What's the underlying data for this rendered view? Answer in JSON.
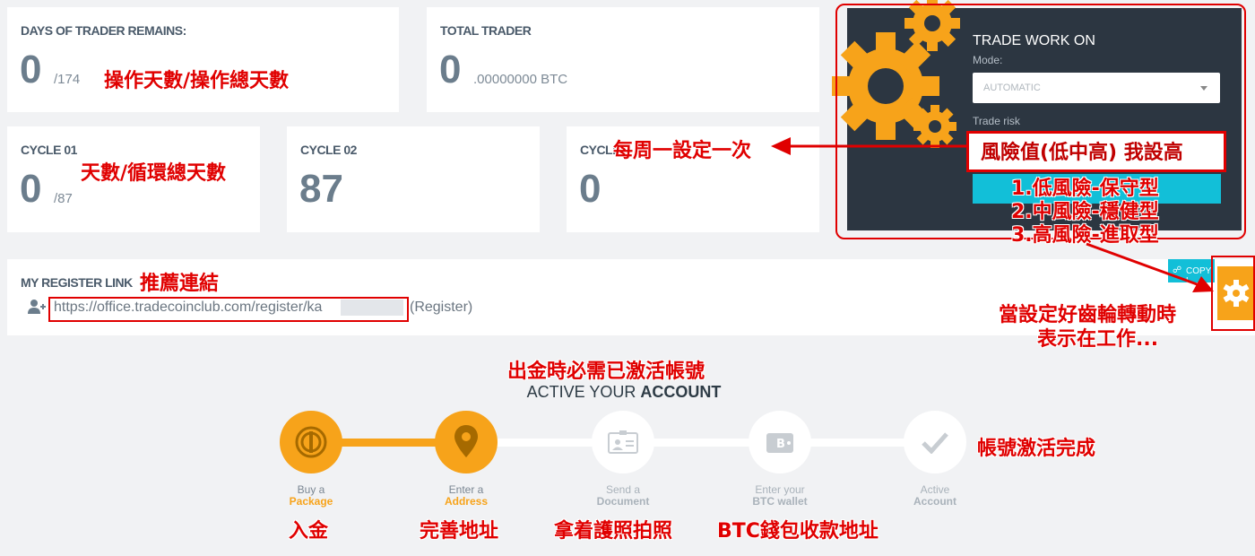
{
  "stats": {
    "days_remains": {
      "label": "DAYS OF TRADER REMAINS:",
      "value": "0",
      "total": "/174"
    },
    "total_trader": {
      "label": "TOTAL TRADER",
      "value": "0",
      "unit": ".00000000 BTC"
    },
    "cycle01": {
      "label": "CYCLE 01",
      "value": "0",
      "total": "/87"
    },
    "cycle02": {
      "label": "CYCLE 02",
      "value": "87"
    },
    "cycle03": {
      "label": "CYCLE",
      "value": "0"
    }
  },
  "trade": {
    "title": "TRADE WORK ON",
    "mode_label": "Mode:",
    "mode_value": "AUTOMATIC",
    "risk_label": "Trade risk"
  },
  "register": {
    "title": "MY REGISTER LINK",
    "url": "https://office.tradecoinclub.com/register/ka",
    "suffix": "(Register)",
    "copy_label": "COPY L"
  },
  "activation": {
    "title_plain": "ACTIVE YOUR ",
    "title_bold": "ACCOUNT",
    "steps": [
      {
        "line1": "Buy a",
        "line2": "Package"
      },
      {
        "line1": "Enter a",
        "line2": "Address"
      },
      {
        "line1": "Send a",
        "line2": "Document"
      },
      {
        "line1": "Enter your",
        "line2": "BTC wallet"
      },
      {
        "line1": "Active",
        "line2": "Account"
      }
    ]
  },
  "annotations": {
    "days": "操作天數/操作總天數",
    "cycle": "天數/循環總天數",
    "weekly": "每周一設定一次",
    "risk": "風險值(低中高) 我設高",
    "risk_levels": [
      "1.低風險-保守型",
      "2.中風險-穩健型",
      "3.高風險-進取型"
    ],
    "referral": "推薦連結",
    "gear_working": [
      "當設定好齒輪轉動時",
      "表示在工作..."
    ],
    "withdraw": "出金時必需已激活帳號",
    "done": "帳號激活完成",
    "step_notes": [
      "入金",
      "完善地址",
      "拿着護照拍照",
      "BTC錢包收款地址"
    ]
  },
  "colors": {
    "accent": "#f7a31a",
    "dark_panel": "#2c3641",
    "cyan": "#12bfd8",
    "annotation_red": "#e00000"
  }
}
